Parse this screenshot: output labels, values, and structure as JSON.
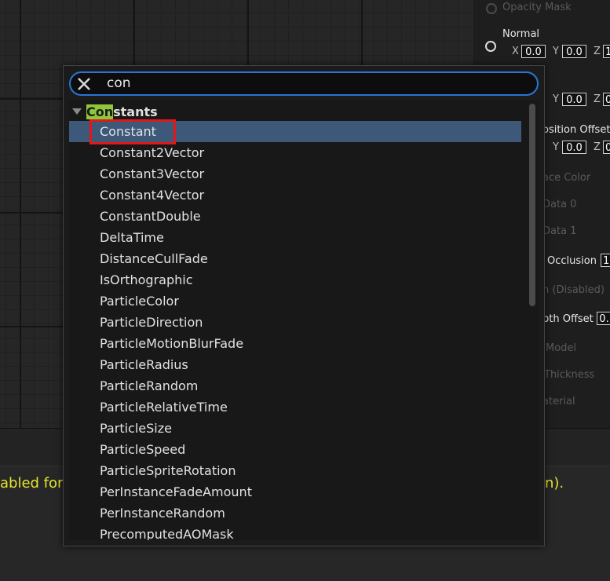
{
  "node_panel": {
    "opacity_mask": "Opacity Mask",
    "normal": "Normal",
    "x_label": "X",
    "y_label": "Y",
    "z_label": "Z",
    "normal_x": "0.0",
    "normal_y": "0.0",
    "normal_z": "1",
    "row2_y": "0.0",
    "row2_z": "0",
    "position_offset": "osition Offset",
    "row3_y": "0.0",
    "row3_z": "0",
    "face_color": "ace Color",
    "data0": "Data 0",
    "data1": "Data 1",
    "occlusion": "Occlusion",
    "occlusion_value": "1",
    "disabled": "n (Disabled)",
    "depth_offset": "pth Offset",
    "depth_value": "0.",
    "model": "Model",
    "thickness": "Thickness",
    "material": "aterial"
  },
  "warning": {
    "left_text": "abled for t",
    "right_text": "n)."
  },
  "search": {
    "query": "con"
  },
  "category": {
    "highlight": "Con",
    "rest": "stants"
  },
  "items": [
    "Constant",
    "Constant2Vector",
    "Constant3Vector",
    "Constant4Vector",
    "ConstantDouble",
    "DeltaTime",
    "DistanceCullFade",
    "IsOrthographic",
    "ParticleColor",
    "ParticleDirection",
    "ParticleMotionBlurFade",
    "ParticleRadius",
    "ParticleRandom",
    "ParticleRelativeTime",
    "ParticleSize",
    "ParticleSpeed",
    "ParticleSpriteRotation",
    "PerInstanceFadeAmount",
    "PerInstanceRandom",
    "PrecomputedAOMask"
  ],
  "selected_index": 0,
  "colors": {
    "accent": "#2a74d4",
    "selection": "#3d5878",
    "highlight": "#8fc73a",
    "annotation": "#e01919",
    "warning": "#e6e62e"
  }
}
